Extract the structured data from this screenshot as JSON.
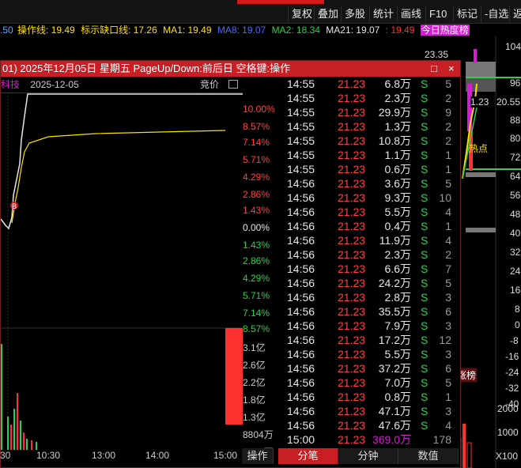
{
  "toolbar": {
    "buttons": [
      "复权",
      "叠加",
      "多股",
      "统计",
      "画线",
      "F10",
      "标记",
      "-自选",
      "返"
    ]
  },
  "indicators": {
    "prefix": ".50",
    "items": [
      {
        "label": "操作线: 19.49",
        "color": "#ffe100"
      },
      {
        "label": "标示缺口线: 17.26",
        "color": "#ffe100"
      },
      {
        "label": "MA1: 19.49",
        "color": "#ffe100"
      },
      {
        "label": "MA8: 19.07",
        "color": "#4a6cff"
      },
      {
        "label": "MA2: 18.34",
        "color": "#2ecf4f"
      },
      {
        "label": "MA21: 19.07",
        "color": "#e6e6e6"
      },
      {
        "label": ": 19.49",
        "color": "#ff3030"
      },
      {
        "label": "今日热度榜",
        "color": "#d020d0"
      }
    ]
  },
  "popup": {
    "title": "01) 2025年12月05日 星期五 PageUp/Down:前后日 空格键:操作",
    "min_btn": "□",
    "close_btn": "×",
    "chart_head": {
      "name": "科技",
      "date": "2025-12-05",
      "price_label": "竞价"
    },
    "pct_labels": [
      {
        "text": "10.00%",
        "color": "#ff4040"
      },
      {
        "text": "8.57%",
        "color": "#ff4040"
      },
      {
        "text": "7.14%",
        "color": "#ff4040"
      },
      {
        "text": "5.71%",
        "color": "#ff4040"
      },
      {
        "text": "4.29%",
        "color": "#ff4040"
      },
      {
        "text": "2.86%",
        "color": "#ff4040"
      },
      {
        "text": "1.43%",
        "color": "#ff4040"
      },
      {
        "text": "0.00%",
        "color": "#e6e6e6"
      },
      {
        "text": "1.43%",
        "color": "#2ecf4f"
      },
      {
        "text": "2.86%",
        "color": "#2ecf4f"
      },
      {
        "text": "4.29%",
        "color": "#2ecf4f"
      },
      {
        "text": "5.71%",
        "color": "#2ecf4f"
      },
      {
        "text": "7.14%",
        "color": "#2ecf4f"
      },
      {
        "text": "8.57%",
        "color": "#2ecf4f"
      }
    ],
    "vol_labels": [
      "3.1亿",
      "2.6亿",
      "2.2亿",
      "1.8亿",
      "1.3亿",
      "8804万",
      "4402万"
    ],
    "time_axis": [
      "30",
      "10:30",
      "13:00",
      "14:00",
      "15:00"
    ],
    "trades": [
      {
        "time": "14:55",
        "price": "21.23",
        "vol": "6.8万",
        "side": "S",
        "cnt": "5"
      },
      {
        "time": "14:55",
        "price": "21.23",
        "vol": "2.3万",
        "side": "S",
        "cnt": "2"
      },
      {
        "time": "14:55",
        "price": "21.23",
        "vol": "29.9万",
        "side": "S",
        "cnt": "9"
      },
      {
        "time": "14:55",
        "price": "21.23",
        "vol": "1.3万",
        "side": "S",
        "cnt": "2"
      },
      {
        "time": "14:55",
        "price": "21.23",
        "vol": "10.8万",
        "side": "S",
        "cnt": "2"
      },
      {
        "time": "14:55",
        "price": "21.23",
        "vol": "1.1万",
        "side": "S",
        "cnt": "1"
      },
      {
        "time": "14:55",
        "price": "21.23",
        "vol": "0.6万",
        "side": "S",
        "cnt": "1"
      },
      {
        "time": "14:56",
        "price": "21.23",
        "vol": "3.6万",
        "side": "S",
        "cnt": "5"
      },
      {
        "time": "14:56",
        "price": "21.23",
        "vol": "9.3万",
        "side": "S",
        "cnt": "10"
      },
      {
        "time": "14:56",
        "price": "21.23",
        "vol": "5.5万",
        "side": "S",
        "cnt": "4"
      },
      {
        "time": "14:56",
        "price": "21.23",
        "vol": "0.4万",
        "side": "S",
        "cnt": "1"
      },
      {
        "time": "14:56",
        "price": "21.23",
        "vol": "11.9万",
        "side": "S",
        "cnt": "4"
      },
      {
        "time": "14:56",
        "price": "21.23",
        "vol": "2.3万",
        "side": "S",
        "cnt": "2"
      },
      {
        "time": "14:56",
        "price": "21.23",
        "vol": "6.6万",
        "side": "S",
        "cnt": "7"
      },
      {
        "time": "14:56",
        "price": "21.23",
        "vol": "24.2万",
        "side": "S",
        "cnt": "5"
      },
      {
        "time": "14:56",
        "price": "21.23",
        "vol": "2.8万",
        "side": "S",
        "cnt": "3"
      },
      {
        "time": "14:56",
        "price": "21.23",
        "vol": "35.5万",
        "side": "S",
        "cnt": "6"
      },
      {
        "time": "14:56",
        "price": "21.23",
        "vol": "7.9万",
        "side": "S",
        "cnt": "3"
      },
      {
        "time": "14:56",
        "price": "21.23",
        "vol": "17.2万",
        "side": "S",
        "cnt": "12"
      },
      {
        "time": "14:56",
        "price": "21.23",
        "vol": "5.5万",
        "side": "S",
        "cnt": "3"
      },
      {
        "time": "14:56",
        "price": "21.23",
        "vol": "37.2万",
        "side": "S",
        "cnt": "6"
      },
      {
        "time": "14:56",
        "price": "21.23",
        "vol": "7.0万",
        "side": "S",
        "cnt": "5"
      },
      {
        "time": "14:56",
        "price": "21.23",
        "vol": "0.8万",
        "side": "S",
        "cnt": "1"
      },
      {
        "time": "14:56",
        "price": "21.23",
        "vol": "47.1万",
        "side": "S",
        "cnt": "3"
      },
      {
        "time": "14:56",
        "price": "21.23",
        "vol": "47.6万",
        "side": "S",
        "cnt": "4"
      },
      {
        "time": "15:00",
        "price": "21.23",
        "vol": "369.0万",
        "side": "",
        "cnt": "178"
      }
    ],
    "bottom_tabs": [
      {
        "label": "操作",
        "active": false
      },
      {
        "label": "分笔",
        "active": true
      },
      {
        "label": "分钟",
        "active": false
      },
      {
        "label": "数值",
        "active": false
      }
    ]
  },
  "kline": {
    "axis_labels": [
      "104",
      "96",
      "88",
      "80",
      "72",
      "64",
      "56",
      "48",
      "40",
      "32",
      "24",
      "16",
      "8",
      "0",
      "-8",
      "-16",
      "-24",
      "-32",
      "-40"
    ],
    "price_high": "23.35",
    "price_current": "20.55",
    "price_mid": "1.23",
    "tag_hot": "热点",
    "tag_list": "涨榜",
    "vol_labels": [
      "2000",
      "1000",
      "X100"
    ]
  }
}
